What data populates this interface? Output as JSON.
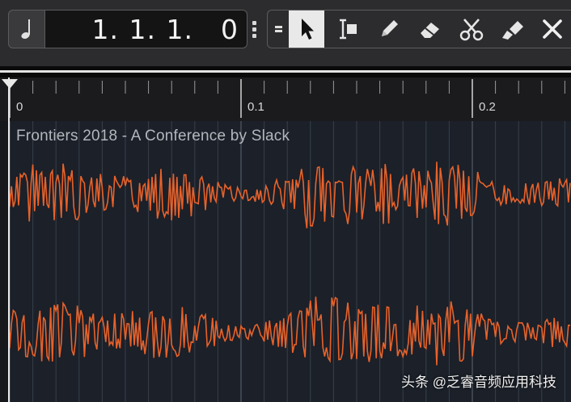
{
  "toolbar": {
    "note_icon": "quarter-note-icon",
    "position_display": [
      "1.",
      "1.",
      "1.",
      "0"
    ],
    "tools": [
      {
        "name": "pointer-icon",
        "active": true
      },
      {
        "name": "range-select-icon",
        "active": false
      },
      {
        "name": "pencil-icon",
        "active": false
      },
      {
        "name": "eraser-icon",
        "active": false
      },
      {
        "name": "scissors-icon",
        "active": false
      },
      {
        "name": "glue-icon",
        "active": false
      },
      {
        "name": "mute-x-icon",
        "active": false
      }
    ]
  },
  "ruler": {
    "labels": [
      "0",
      "0.1",
      "0.2"
    ]
  },
  "event": {
    "title": "Frontiers 2018 - A Conference by Slack",
    "waveform_color": "#e8622a"
  },
  "watermark": "头条 @乏睿音频应用科技"
}
